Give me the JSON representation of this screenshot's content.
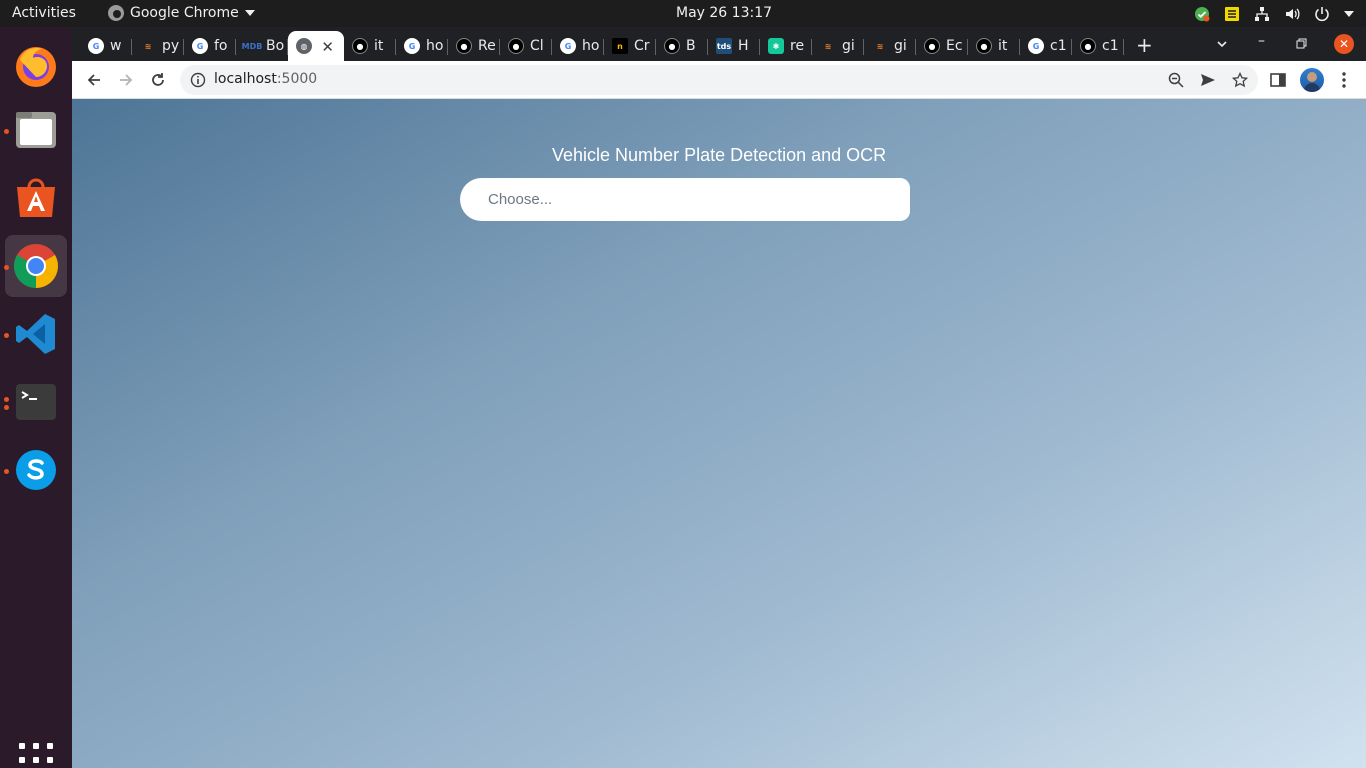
{
  "system": {
    "activities_label": "Activities",
    "app_name": "Google Chrome",
    "datetime": "May 26  13:17"
  },
  "dock": {
    "items": [
      "firefox-icon",
      "files-icon",
      "software-center-icon",
      "chrome-icon",
      "vscode-icon",
      "terminal-icon",
      "skype-icon"
    ],
    "apps_grid": "show-applications-icon"
  },
  "browser": {
    "tabs": [
      {
        "label": "w",
        "icon": "google-icon"
      },
      {
        "label": "py",
        "icon": "stackoverflow-icon"
      },
      {
        "label": "fo",
        "icon": "google-icon"
      },
      {
        "label": "Bo",
        "icon": "mdb-icon"
      },
      {
        "label": "",
        "icon": "globe-icon",
        "active": true
      },
      {
        "label": "it",
        "icon": "github-icon"
      },
      {
        "label": "ho",
        "icon": "google-icon"
      },
      {
        "label": "Re",
        "icon": "github-icon"
      },
      {
        "label": "Cl",
        "icon": "github-icon"
      },
      {
        "label": "ho",
        "icon": "google-icon"
      },
      {
        "label": "Cr",
        "icon": "n-icon"
      },
      {
        "label": "B",
        "icon": "github-icon"
      },
      {
        "label": "H",
        "icon": "tds-icon"
      },
      {
        "label": "re",
        "icon": "green-app-icon"
      },
      {
        "label": "gi",
        "icon": "stackoverflow-icon"
      },
      {
        "label": "gi",
        "icon": "stackoverflow-icon"
      },
      {
        "label": "Ec",
        "icon": "github-icon"
      },
      {
        "label": "it",
        "icon": "github-icon"
      },
      {
        "label": "c1",
        "icon": "google-icon"
      },
      {
        "label": "c1",
        "icon": "github-icon"
      }
    ],
    "address": {
      "host": "localhost",
      "port": ":5000"
    }
  },
  "page": {
    "title": "Vehicle Number Plate Detection and OCR",
    "file_input_placeholder": "Choose..."
  },
  "colors": {
    "topbar": "#1d1d1d",
    "dock": "#2b1a2a",
    "tabstrip": "#202124",
    "ubuntu_orange": "#e95420",
    "page_gradient_start": "#4e7596",
    "page_gradient_end": "#d1e2ef"
  }
}
